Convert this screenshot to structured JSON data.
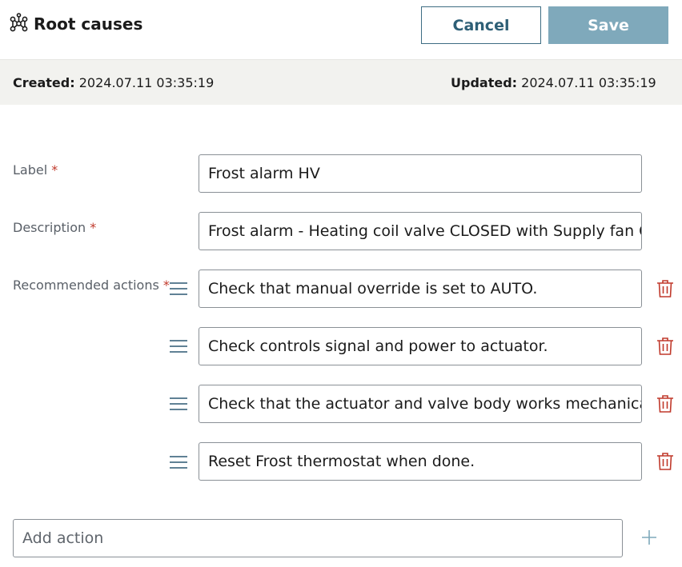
{
  "header": {
    "title": "Root causes",
    "cancel_label": "Cancel",
    "save_label": "Save",
    "icon": "network-icon"
  },
  "meta": {
    "created_label": "Created:",
    "created_value": "2024.07.11 03:35:19",
    "updated_label": "Updated:",
    "updated_value": "2024.07.11 03:35:19"
  },
  "form": {
    "label": {
      "label": "Label",
      "required": "*",
      "value": "Frost alarm HV"
    },
    "description": {
      "label": "Description",
      "required": "*",
      "value": "Frost alarm - Heating coil valve CLOSED with Supply fan ON"
    },
    "recommended_actions": {
      "label": "Recommended actions",
      "required": "*",
      "items": [
        {
          "value": "Check that manual override is set to AUTO."
        },
        {
          "value": "Check controls signal and power to actuator."
        },
        {
          "value": "Check that the actuator and valve body works mechanically."
        },
        {
          "value": "Reset Frost thermostat when done."
        }
      ]
    },
    "add_action": {
      "placeholder": "Add action"
    }
  },
  "colors": {
    "accent": "#2e5f76",
    "save_bg": "#7fa9bb",
    "delete": "#c0392b",
    "meta_bg": "#f2f2ef"
  }
}
